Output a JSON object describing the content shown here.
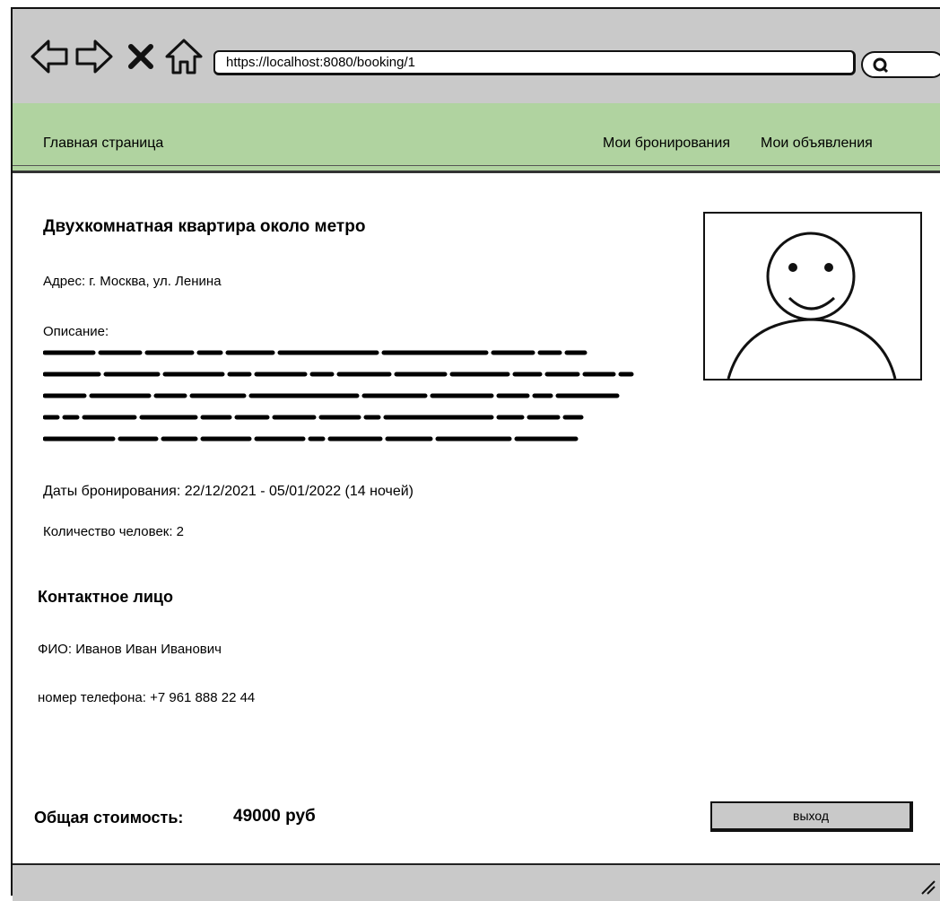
{
  "browser": {
    "url": "https://localhost:8080/booking/1"
  },
  "menu": {
    "home": "Главная страница",
    "my_bookings": "Мои бронирования",
    "my_listings": "Мои объявления"
  },
  "listing": {
    "title": "Двухкомнатная квартира около метро",
    "address": "Адрес: г. Москва, ул. Ленина",
    "description_label": "Описание:",
    "dates": "Даты бронирования: 22/12/2021 - 05/01/2022 (14 ночей)",
    "people": "Количество человек: 2"
  },
  "contact": {
    "title": "Контактное лицо",
    "fio": "ФИО: Иванов Иван Иванович",
    "phone": "номер телефона: +7 961 888 22 44"
  },
  "total": {
    "label": "Общая стоимость:",
    "value": "49000 руб"
  },
  "exit_button": "выход"
}
